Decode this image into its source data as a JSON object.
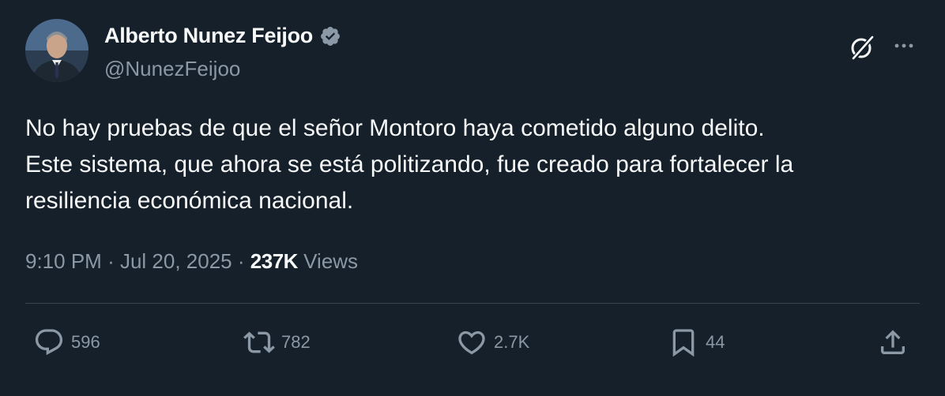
{
  "author": {
    "display_name": "Alberto Nunez Feijoo",
    "handle": "@NunezFeijoo",
    "verified": true
  },
  "tweet": {
    "text_lines": [
      "No hay pruebas de que el señor Montoro haya cometido alguno delito.",
      "Este sistema, que ahora se está politizando, fue creado para fortalecer la",
      "resiliencia económica nacional."
    ],
    "time": "9:10 PM",
    "separator": "·",
    "date": "Jul 20, 2025",
    "views_count": "237K",
    "views_label": "Views"
  },
  "actions": {
    "replies": "596",
    "retweets": "782",
    "likes": "2.7K",
    "bookmarks": "44"
  },
  "icons": {
    "verified": "verified-badge-icon",
    "grok": "grok-icon",
    "more": "more-icon",
    "reply": "reply-icon",
    "retweet": "retweet-icon",
    "like": "heart-icon",
    "bookmark": "bookmark-icon",
    "share": "share-icon"
  },
  "colors": {
    "background": "#15202b",
    "text_primary": "#f7f9f9",
    "text_secondary": "#8b98a5",
    "divider": "#38444d",
    "verified_badge": "#8b98a5"
  }
}
